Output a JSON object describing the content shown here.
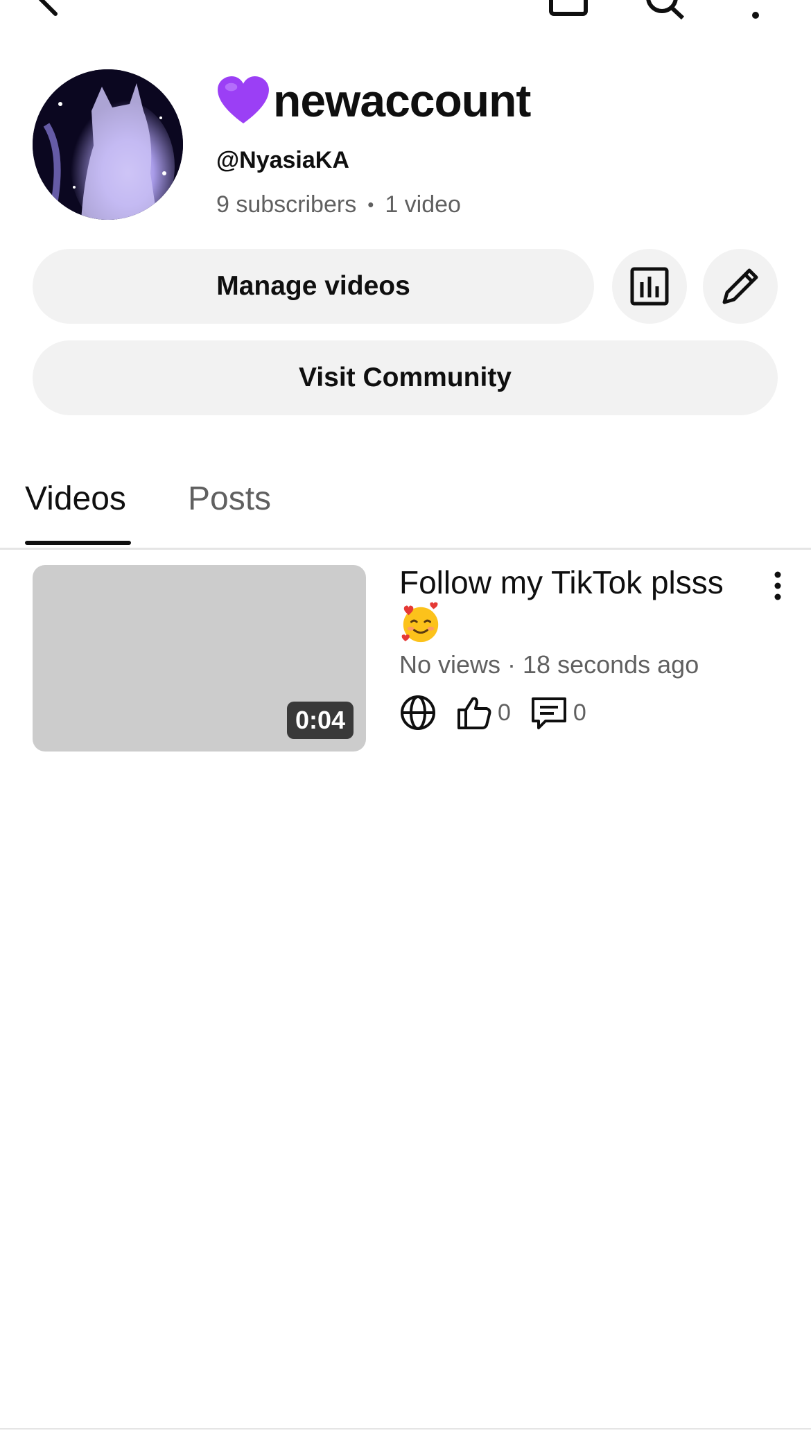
{
  "channel": {
    "name": "newaccount",
    "handle": "@NyasiaKA",
    "subscribers": "9 subscribers",
    "separator": "•",
    "video_count": "1 video"
  },
  "actions": {
    "manage_videos": "Manage videos",
    "visit_community": "Visit Community"
  },
  "tabs": [
    {
      "label": "Videos",
      "active": true
    },
    {
      "label": "Posts",
      "active": false
    }
  ],
  "video": {
    "title": "Follow my TikTok plsss",
    "duration": "0:04",
    "meta": "No views · 18 seconds ago",
    "likes": "0",
    "comments": "0"
  },
  "icons": {
    "heart": "purple-heart-icon",
    "analytics": "analytics-icon",
    "edit": "pencil-icon",
    "more": "more-vert-icon",
    "visibility": "globe-icon",
    "likes": "thumbs-up-icon",
    "comments": "comment-icon",
    "emoji": "smiling-face-with-hearts-icon"
  },
  "colors": {
    "heart": "#9b3ff5",
    "button_bg": "#f2f2f2",
    "secondary_text": "#606060"
  }
}
